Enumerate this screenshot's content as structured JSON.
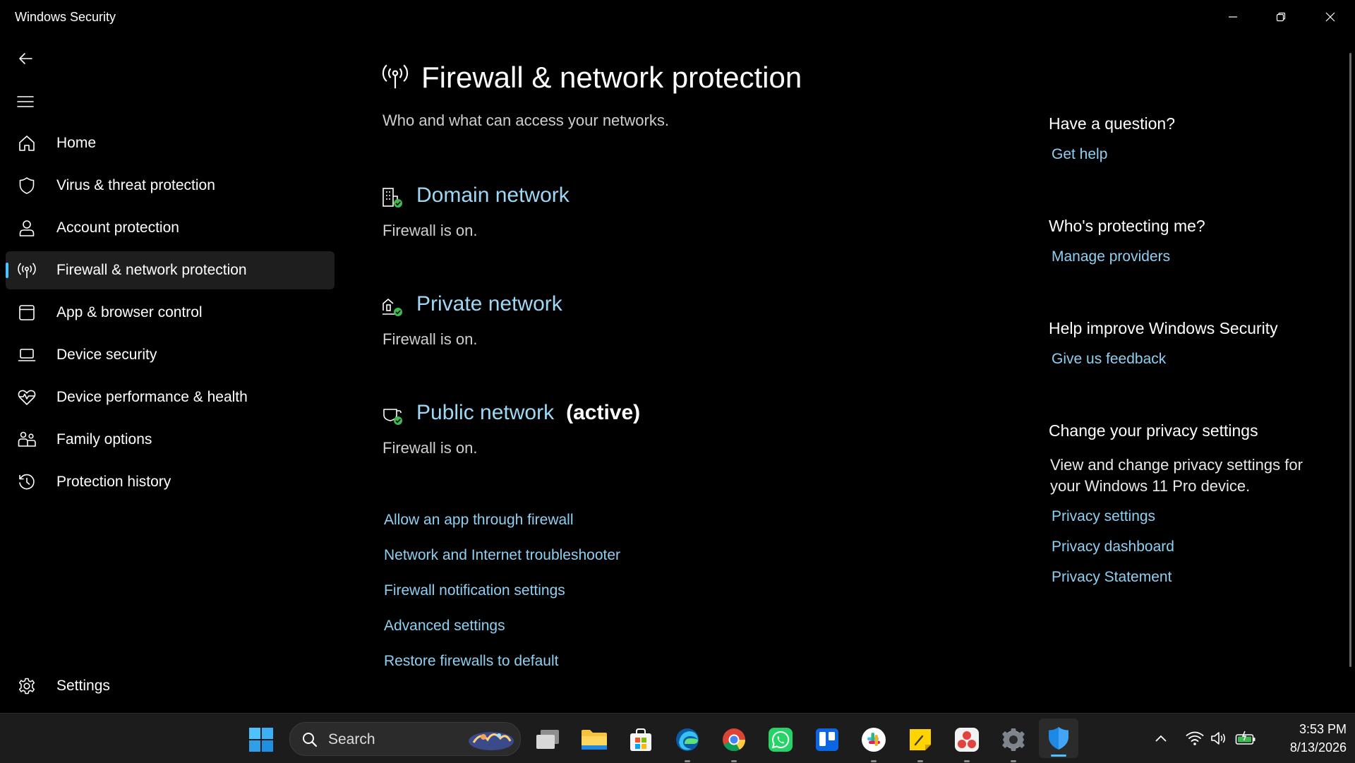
{
  "window": {
    "title": "Windows Security"
  },
  "sidebar": {
    "items": [
      {
        "label": "Home",
        "icon": "home-icon"
      },
      {
        "label": "Virus & threat protection",
        "icon": "shield-icon"
      },
      {
        "label": "Account protection",
        "icon": "person-icon"
      },
      {
        "label": "Firewall & network protection",
        "icon": "wireless-antenna-icon",
        "active": true
      },
      {
        "label": "App & browser control",
        "icon": "app-window-icon"
      },
      {
        "label": "Device security",
        "icon": "laptop-icon"
      },
      {
        "label": "Device performance & health",
        "icon": "heart-pulse-icon"
      },
      {
        "label": "Family options",
        "icon": "family-icon"
      },
      {
        "label": "Protection history",
        "icon": "history-icon"
      }
    ],
    "settings_label": "Settings"
  },
  "main": {
    "title": "Firewall & network protection",
    "subtitle": "Who and what can access your networks.",
    "networks": [
      {
        "name": "Domain network",
        "status": "Firewall is on.",
        "active_label": ""
      },
      {
        "name": "Private network",
        "status": "Firewall is on.",
        "active_label": ""
      },
      {
        "name": "Public network",
        "status": "Firewall is on.",
        "active_label": "(active)"
      }
    ],
    "links": [
      "Allow an app through firewall",
      "Network and Internet troubleshooter",
      "Firewall notification settings",
      "Advanced settings",
      "Restore firewalls to default"
    ]
  },
  "right_panel": {
    "question_heading": "Have a question?",
    "get_help": "Get help",
    "protecting_heading": "Who's protecting me?",
    "manage_providers": "Manage providers",
    "improve_heading": "Help improve Windows Security",
    "feedback": "Give us feedback",
    "privacy_heading": "Change your privacy settings",
    "privacy_description": "View and change privacy settings for your Windows 11 Pro device.",
    "privacy_links": [
      "Privacy settings",
      "Privacy dashboard",
      "Privacy Statement"
    ]
  },
  "taskbar": {
    "search_label": "Search",
    "apps": [
      "task-view",
      "file-explorer",
      "microsoft-store",
      "edge",
      "chrome",
      "whatsapp",
      "trello",
      "slack",
      "sticky-notes",
      "davinci",
      "settings",
      "windows-security"
    ],
    "time": "3:53 PM",
    "date": "8/13/2026"
  },
  "colors": {
    "background": "#000000",
    "link": "#8fd0f2",
    "accent": "#4cc2ff",
    "status_ok": "#3fb950",
    "taskbar": "#1c1c1c"
  }
}
